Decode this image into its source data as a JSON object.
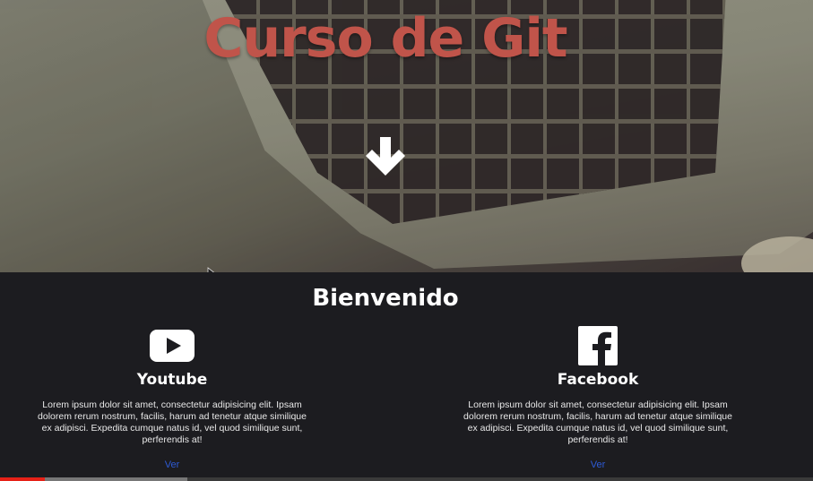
{
  "hero": {
    "title": "Curso de Git",
    "title_color": "#c0544a",
    "arrow_icon": "arrow-down-icon"
  },
  "main": {
    "section_title": "Bienvenido",
    "cards": [
      {
        "icon": "youtube-icon",
        "title": "Youtube",
        "text": "Lorem ipsum dolor sit amet, consectetur adipisicing elit. Ipsam dolorem rerum nostrum, facilis, harum ad tenetur atque similique ex adipisci. Expedita cumque natus id, vel quod similique sunt, perferendis at!",
        "link": "Ver"
      },
      {
        "icon": "facebook-icon",
        "title": "Facebook",
        "text": "Lorem ipsum dolor sit amet, consectetur adipisicing elit. Ipsam dolorem rerum nostrum, facilis, harum ad tenetur atque similique ex adipisci. Expedita cumque natus id, vel quod similique sunt, perferendis at!",
        "link": "Ver"
      }
    ],
    "link_color": "#2e5bd6"
  },
  "player": {
    "progress_played": 0.055,
    "progress_buffered": 0.23,
    "played_color": "#e62117"
  }
}
